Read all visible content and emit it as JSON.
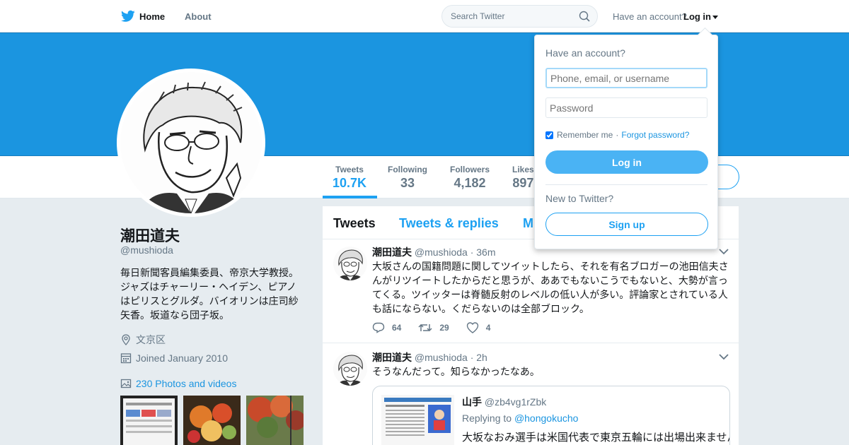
{
  "nav": {
    "home_label": "Home",
    "about_label": "About",
    "search_placeholder": "Search Twitter",
    "have_account_label": "Have an account?",
    "login_label": "Log in"
  },
  "colors": {
    "brand": "#1da1f2",
    "banner": "#1b95e0",
    "login_button": "#4ab3f4"
  },
  "profile": {
    "name": "潮田道夫",
    "handle": "@mushioda",
    "bio": "毎日新聞客員編集委員、帝京大学教授。ジャズはチャーリー・ヘイデン、ピアノはピリスとグルダ。バイオリンは庄司紗矢香。坂道なら団子坂。",
    "location": "文京区",
    "joined": "Joined January 2010",
    "photos_label": "230 Photos and videos"
  },
  "stats": [
    {
      "label": "Tweets",
      "value": "10.7K"
    },
    {
      "label": "Following",
      "value": "33"
    },
    {
      "label": "Followers",
      "value": "4,182"
    },
    {
      "label": "Likes",
      "value": "897"
    }
  ],
  "tabs": [
    "Tweets",
    "Tweets & replies",
    "M"
  ],
  "tweets": [
    {
      "name": "潮田道夫",
      "handle": "@mushioda",
      "time": "· 36m",
      "text": "大坂さんの国籍問題に関してツイットしたら、それを有名ブロガーの池田信夫さんがリツイートしたからだと思うが、ああでもないこうでもないと、大勢が言ってくる。ツイッターは脊髄反射のレベルの低い人が多い。評論家とされている人も話にならない。くだらないのは全部ブロック。",
      "replies": "64",
      "retweets": "29",
      "likes": "4"
    },
    {
      "name": "潮田道夫",
      "handle": "@mushioda",
      "time": "· 2h",
      "text": "そうなんだって。知らなかったなあ。",
      "quote": {
        "name": "山手",
        "handle": "@zb4vg1rZbk",
        "replying_prefix": "Replying to",
        "replying_to": "@hongokucho",
        "text": "大坂なおみ選手は米国代表で東京五輪には出場出来ません"
      }
    }
  ],
  "login_dropdown": {
    "title": "Have an account?",
    "username_placeholder": "Phone, email, or username",
    "password_placeholder": "Password",
    "remember_label": "Remember me",
    "separator": "·",
    "forgot_label": "Forgot password?",
    "login_button": "Log in",
    "new_label": "New to Twitter?",
    "signup_button": "Sign up"
  }
}
